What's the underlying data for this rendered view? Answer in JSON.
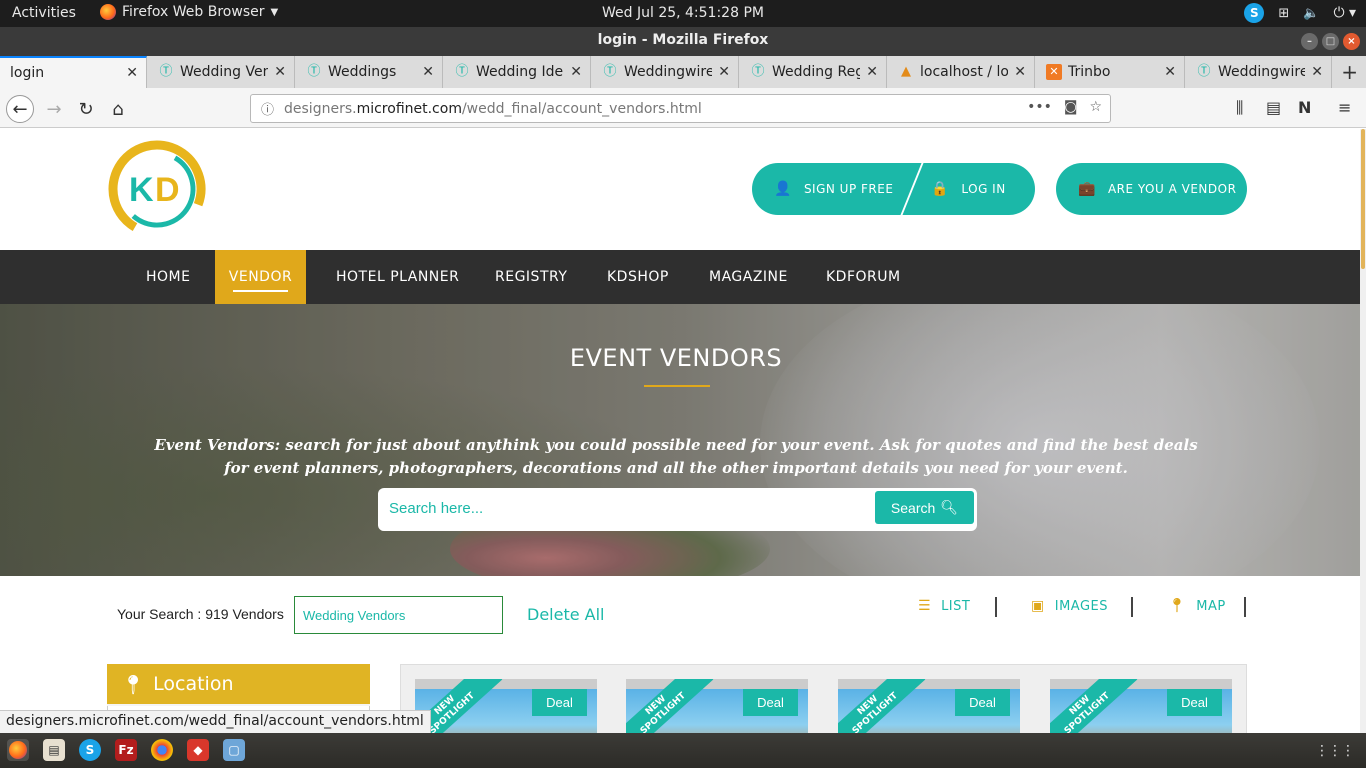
{
  "system": {
    "activities": "Activities",
    "app_name": "Firefox Web Browser",
    "clock": "Wed Jul 25,  4:51:28 PM"
  },
  "window": {
    "title": "login - Mozilla Firefox"
  },
  "tabs": [
    {
      "label": "login",
      "icon": "none"
    },
    {
      "label": "Wedding Vendors",
      "icon": "site-icon"
    },
    {
      "label": "Weddings",
      "icon": "site-icon"
    },
    {
      "label": "Wedding Ideas",
      "icon": "site-icon"
    },
    {
      "label": "Weddingwire",
      "icon": "site-icon"
    },
    {
      "label": "Wedding Registry",
      "icon": "site-icon"
    },
    {
      "label": "localhost / localhost",
      "icon": "phpmyadmin-icon"
    },
    {
      "label": "Trinbo",
      "icon": "xampp-icon"
    },
    {
      "label": "Weddingwire",
      "icon": "site-icon"
    }
  ],
  "urlbar": {
    "url_prefix": "designers.",
    "url_domain": "microfinet.com",
    "url_path": "/wedd_final/account_vendors.html"
  },
  "header": {
    "signup": "SIGN UP FREE",
    "login": "LOG IN",
    "vendor": "ARE YOU A VENDOR"
  },
  "nav": {
    "items": [
      "HOME",
      "VENDOR",
      "HOTEL PLANNER",
      "REGISTRY",
      "KDSHOP",
      "MAGAZINE",
      "KDFORUM"
    ],
    "active": "VENDOR"
  },
  "hero": {
    "title": "EVENT VENDORS",
    "text": "Event Vendors: search for just about anythink you could possible need for your event. Ask for quotes and find the best deals for event planners, photographers, decorations and all the other important details you need for your event.",
    "search_placeholder": "Search here...",
    "search_button": "Search"
  },
  "results": {
    "your_search": "Your Search : 919 Vendors",
    "filter_value": "Wedding Vendors",
    "delete_all": "Delete All",
    "views": [
      "LIST",
      "IMAGES",
      "MAP"
    ]
  },
  "sidebar": {
    "location_title": "Location"
  },
  "cards": [
    {
      "ribbon_top": "NEW",
      "ribbon_bottom": "SPOTLIGHT",
      "badge": "Deal"
    },
    {
      "ribbon_top": "NEW",
      "ribbon_bottom": "SPOTLIGHT",
      "badge": "Deal"
    },
    {
      "ribbon_top": "NEW",
      "ribbon_bottom": "SPOTLIGHT",
      "badge": "Deal"
    },
    {
      "ribbon_top": "NEW",
      "ribbon_bottom": "SPOTLIGHT",
      "badge": "Deal"
    }
  ],
  "status": "designers.microfinet.com/wedd_final/account_vendors.html",
  "colors": {
    "teal": "#1bb8a8",
    "gold": "#e0a81b",
    "nav_bg": "#2f2f2f"
  }
}
